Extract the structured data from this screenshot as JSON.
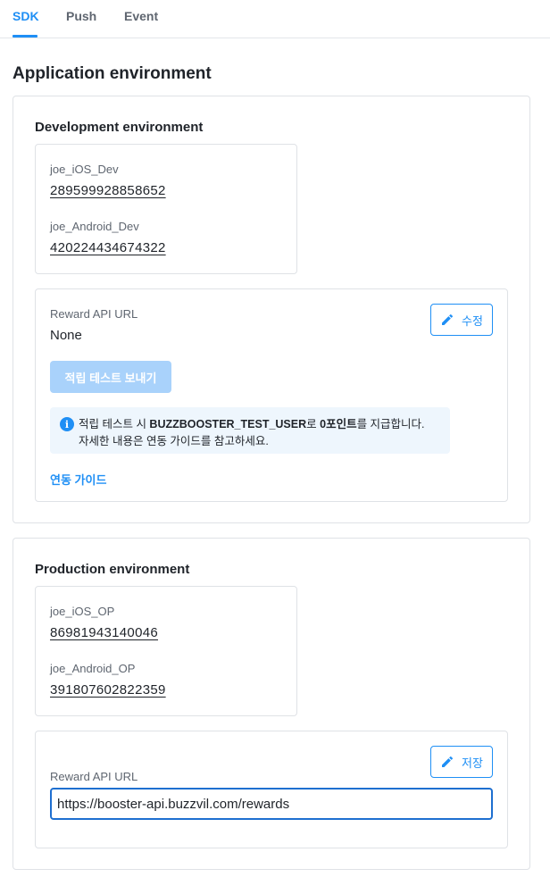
{
  "tabs": [
    {
      "label": "SDK"
    },
    {
      "label": "Push"
    },
    {
      "label": "Event"
    }
  ],
  "page_title": "Application environment",
  "development": {
    "title": "Development environment",
    "keys": [
      {
        "label": "joe_iOS_Dev",
        "value": "289599928858652"
      },
      {
        "label": "joe_Android_Dev",
        "value": "420224434674322"
      }
    ],
    "reward": {
      "label": "Reward API URL",
      "value": "None",
      "edit_button": "수정",
      "send_test_button": "적립 테스트 보내기",
      "notice": {
        "prefix": "적립 테스트 시 ",
        "user": "BUZZBOOSTER_TEST_USER",
        "middle": "로 ",
        "points": "0포인트",
        "suffix": "를 지급합니다.",
        "line2": "자세한 내용은 연동 가이드를 참고하세요."
      },
      "guide_link": "연동 가이드"
    }
  },
  "production": {
    "title": "Production environment",
    "keys": [
      {
        "label": "joe_iOS_OP",
        "value": "86981943140046"
      },
      {
        "label": "joe_Android_OP",
        "value": "391807602822359"
      }
    ],
    "reward": {
      "label": "Reward API URL",
      "save_button": "저장",
      "input_value": "https://booster-api.buzzvil.com/rewards"
    }
  },
  "colors": {
    "accent": "#1f8ff5",
    "disabled_button": "#a9d2fb",
    "notice_bg": "#eef6fd",
    "border": "#dfe2e6"
  },
  "icons": {
    "edit": "pencil-icon",
    "info": "info-icon"
  }
}
